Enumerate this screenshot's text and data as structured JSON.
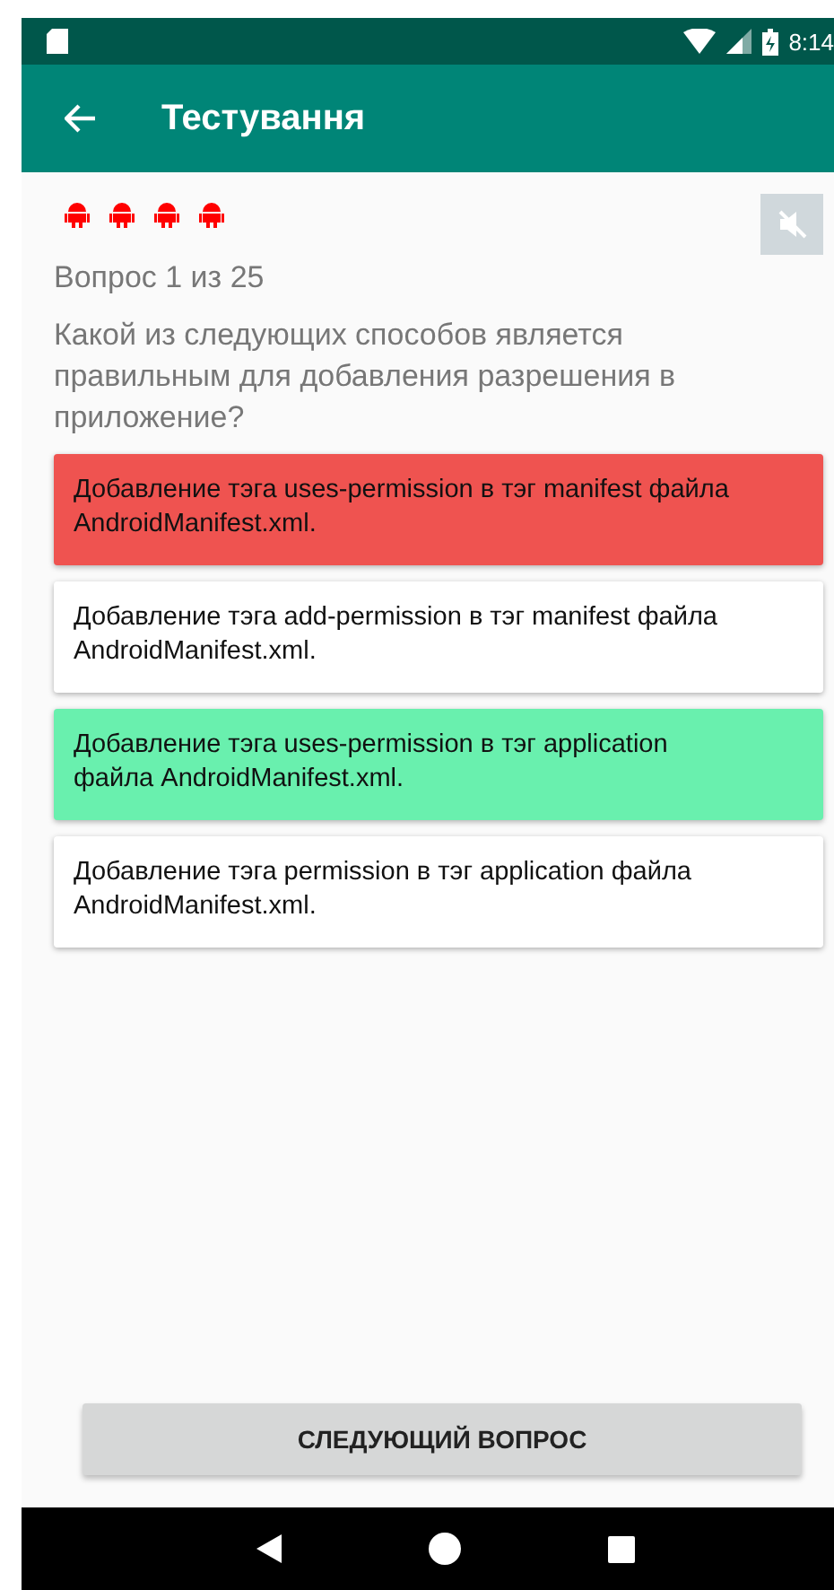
{
  "status_bar": {
    "time": "8:14"
  },
  "app_bar": {
    "title": "Тестування"
  },
  "sound": {
    "muted": true
  },
  "progress": "Вопрос 1 из 25",
  "question": "Какой из следующих способов является правильным для добавления разрешения в приложение?",
  "answers": [
    {
      "text": "Добавление тэга uses-permission в тэг manifest файла AndroidManifest.xml.",
      "color": "#ef5350"
    },
    {
      "text": "Добавление тэга add-permission в тэг manifest файла AndroidManifest.xml.",
      "color": "#ffffff"
    },
    {
      "text": "Добавление тэга uses-permission в тэг application файла AndroidManifest.xml.",
      "color": "#69f0ae"
    },
    {
      "text": "Добавление тэга permission в тэг application файла AndroidManifest.xml.",
      "color": "#ffffff"
    }
  ],
  "next_button": "СЛЕДУЮЩИЙ ВОПРОС"
}
